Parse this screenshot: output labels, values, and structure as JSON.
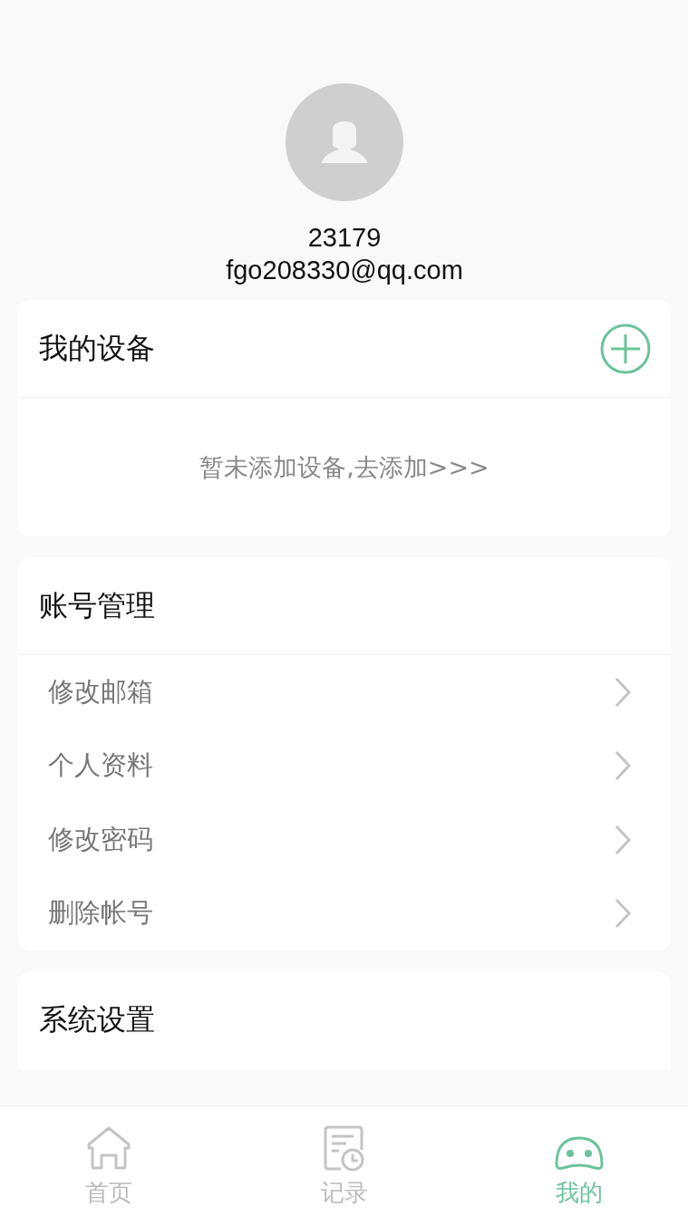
{
  "profile": {
    "username": "23179",
    "email": "fgo208330@qq.com"
  },
  "devices": {
    "title": "我的设备",
    "empty_text": "暂未添加设备,去添加>>>"
  },
  "account": {
    "title": "账号管理",
    "items": [
      {
        "label": "修改邮箱"
      },
      {
        "label": "个人资料"
      },
      {
        "label": "修改密码"
      },
      {
        "label": "删除帐号"
      }
    ]
  },
  "settings": {
    "title": "系统设置"
  },
  "tab_bar": [
    {
      "label": "首页",
      "selected": false
    },
    {
      "label": "记录",
      "selected": false
    },
    {
      "label": "我的",
      "selected": true
    }
  ]
}
